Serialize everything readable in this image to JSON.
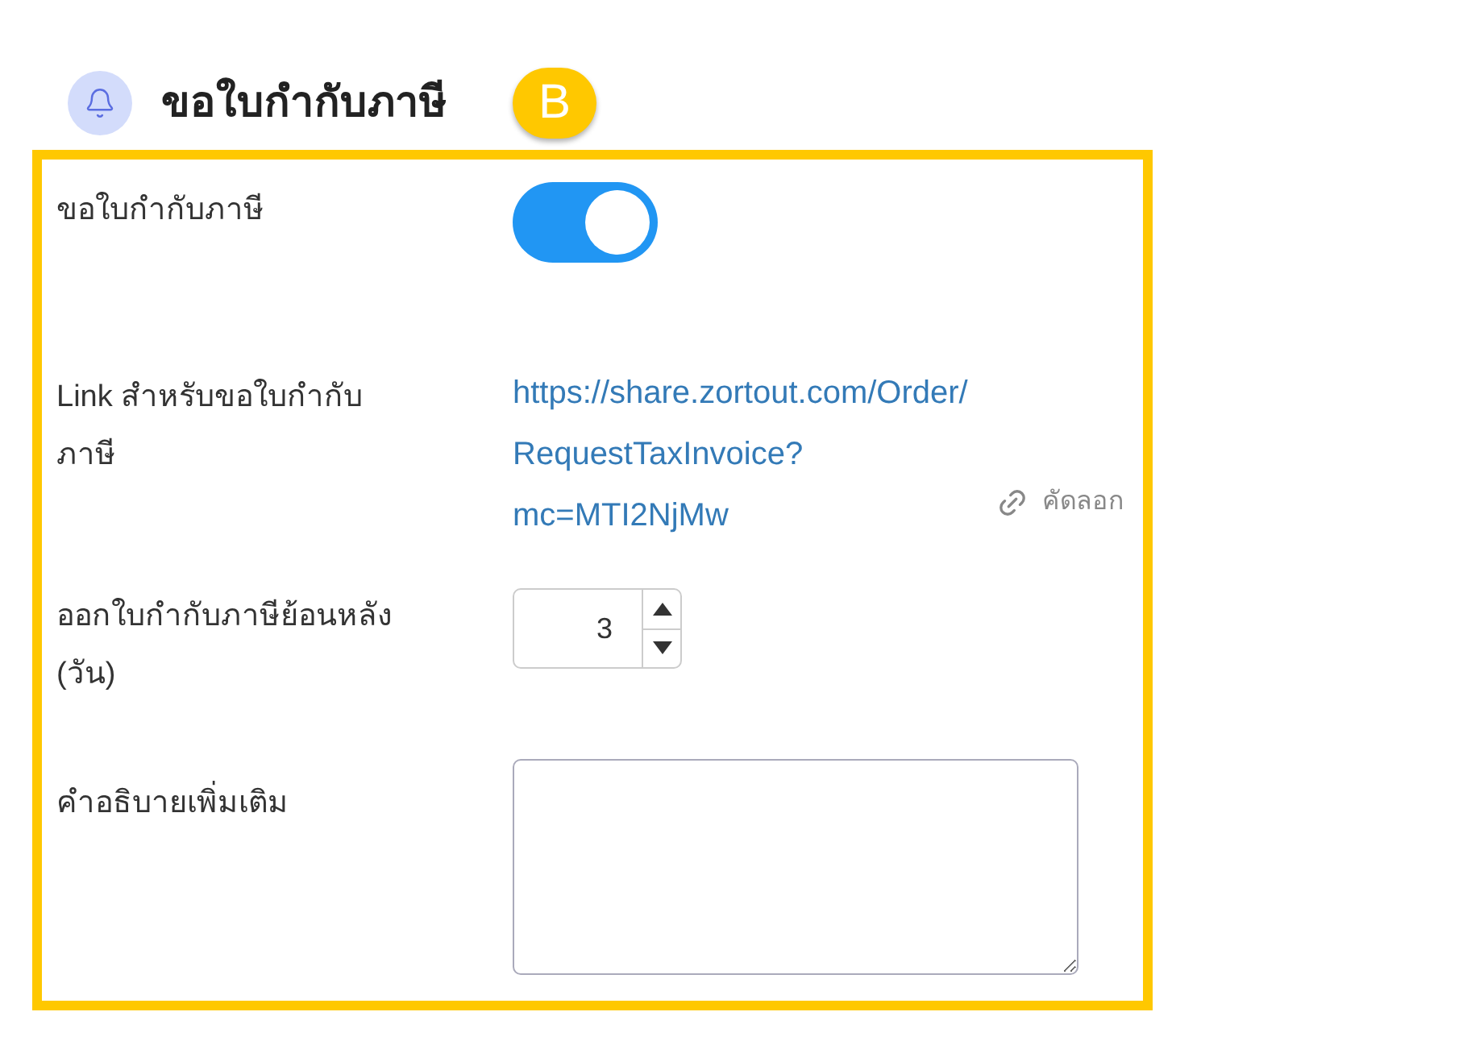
{
  "header": {
    "title": "ขอใบกำกับภาษี",
    "badge": "B"
  },
  "form": {
    "rows": [
      {
        "kind": "toggle",
        "label": "ขอใบกำกับภาษี",
        "on": true
      },
      {
        "kind": "link",
        "label": "Link สำหรับขอใบกำกับภาษี",
        "url_lines": [
          "https://share.zortout.com/Order/",
          "RequestTaxInvoice?",
          "mc=MTI2NjMw"
        ],
        "copy": "คัดลอก"
      },
      {
        "kind": "number",
        "label": "ออกใบกำกับภาษีย้อนหลัง (วัน)",
        "value": "3"
      },
      {
        "kind": "textarea",
        "label": "คำอธิบายเพิ่มเติม"
      }
    ]
  }
}
